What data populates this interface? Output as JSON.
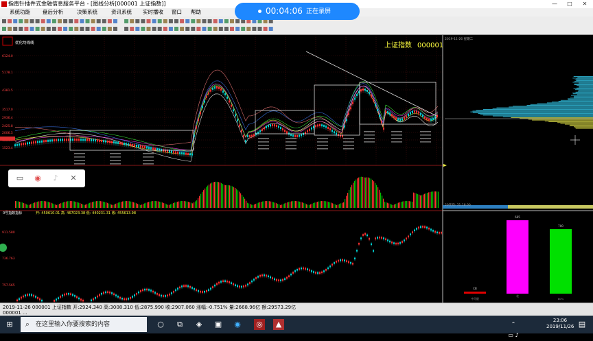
{
  "window": {
    "title": "指南针插件式金融信息服务平台 - [图线分析[000001 上证指数]]",
    "minimize": "—",
    "maximize": "□",
    "close": "✕"
  },
  "menu": [
    "系统功能",
    "盘后分析",
    "决策系统",
    "资讯系统",
    "实时播收",
    "窗口",
    "帮助"
  ],
  "recording": {
    "time": "00:04:06",
    "status": "正在录屏"
  },
  "chart": {
    "index_name": "上证指数",
    "index_code": "000001",
    "indicator_label": "优化均线线",
    "volume_label": "0号指数指标",
    "volume_values": "开: 450610.01  高: 467023.38  低: 440231.31  收: 455613.98",
    "right_label_1": "2019-11-26 星期二",
    "right_label_2": "20天均: 31.18.00",
    "y_labels_main": [
      "6124.0",
      "5178.1",
      "4381.5",
      "3517.0",
      "2936.4",
      "2425.8",
      "2006.5",
      "1664.9",
      "1523.4"
    ],
    "y_labels_lower": [
      "911.580",
      "736.763",
      "757.565"
    ],
    "bar_labels": [
      "CB",
      "665",
      "700"
    ],
    "bar_sublabels": [
      "中马键",
      "北",
      "80%"
    ]
  },
  "status": {
    "line1": "2019-11-26 000001 上证指数 开:2924.340 高:3008.310 低:2875.990 收:2907.060 涨幅:-0.751% 量:2668.96亿 额:29573.29亿",
    "line2": "000001  ..."
  },
  "taskbar": {
    "search_placeholder": "在这里输入你要搜索的内容",
    "time": "23:06",
    "date": "2019/11/26"
  },
  "colors": {
    "accent_blue": "#1e88ff",
    "candle_up": "#ff3030",
    "candle_down": "#00d000",
    "magenta_bar": "#ff00ff",
    "green_bar": "#00e000"
  }
}
